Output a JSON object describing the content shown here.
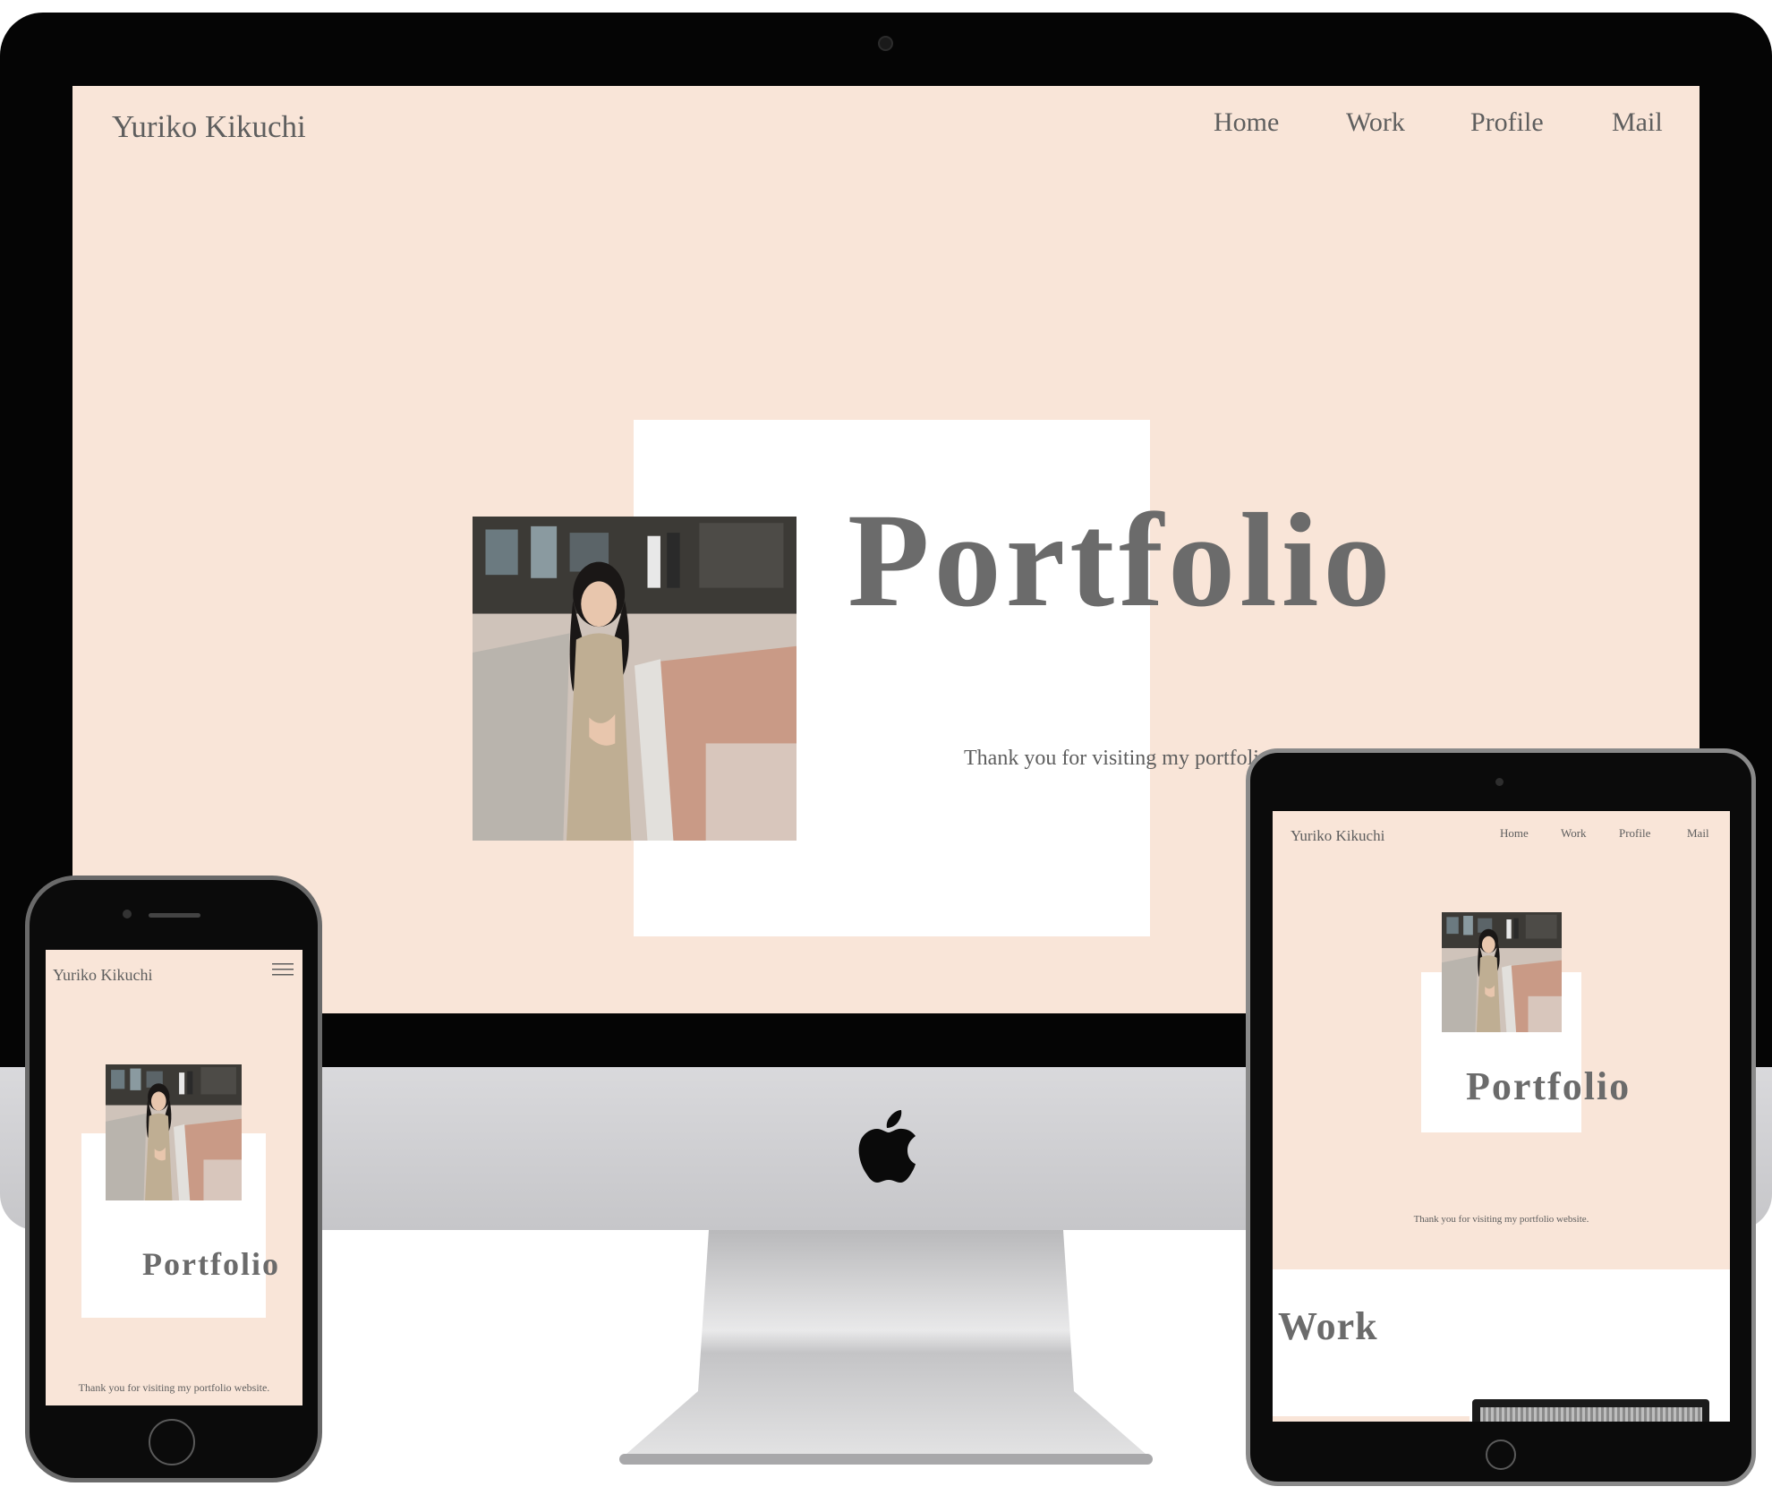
{
  "site": {
    "logo": "Yuriko Kikuchi",
    "nav": [
      "Home",
      "Work",
      "Profile",
      "Mail"
    ],
    "hero_title": "Portfolio",
    "hero_subtitle": "Thank you for visiting my portfolio website.",
    "hero_subtitle_desktop_visible": "Thank you for visiting my portfoli",
    "section_title": "Work"
  },
  "icons": {
    "menu": "hamburger-menu-icon",
    "brand": "apple-logo-icon"
  },
  "colors": {
    "background": "#f9e5d8",
    "text": "#5e5e5e",
    "title": "#6b6b6b",
    "frame": "#ffffff",
    "device": "#050505"
  }
}
